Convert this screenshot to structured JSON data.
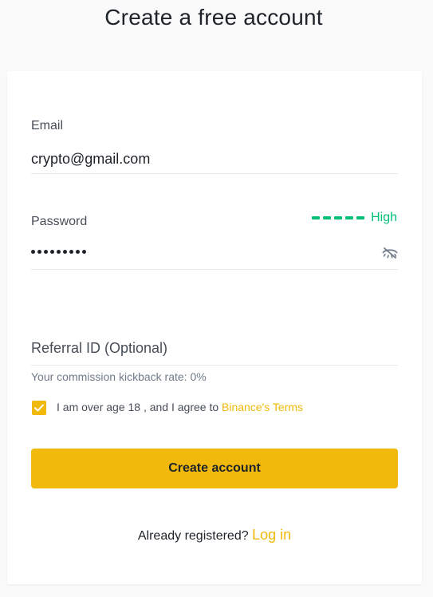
{
  "page": {
    "title": "Create a free account"
  },
  "form": {
    "email": {
      "label": "Email",
      "value": "crypto@gmail.com"
    },
    "password": {
      "label": "Password",
      "masked_value": "•••••••••",
      "strength_label": "High",
      "strength_color": "#02c076",
      "toggle_icon": "eye-off-icon"
    },
    "referral": {
      "placeholder": "Referral ID (Optional)",
      "commission_text": "Your commission kickback rate: 0%"
    },
    "agreement": {
      "checked": true,
      "text": "I am over age 18 , and I agree to ",
      "link_text": "Binance's Terms"
    },
    "submit_label": "Create account"
  },
  "footer": {
    "already_text": "Already registered? ",
    "login_label": "Log in"
  },
  "colors": {
    "accent": "#f0b90b",
    "success": "#02c076",
    "text": "#1e2329",
    "muted": "#707a8a"
  }
}
